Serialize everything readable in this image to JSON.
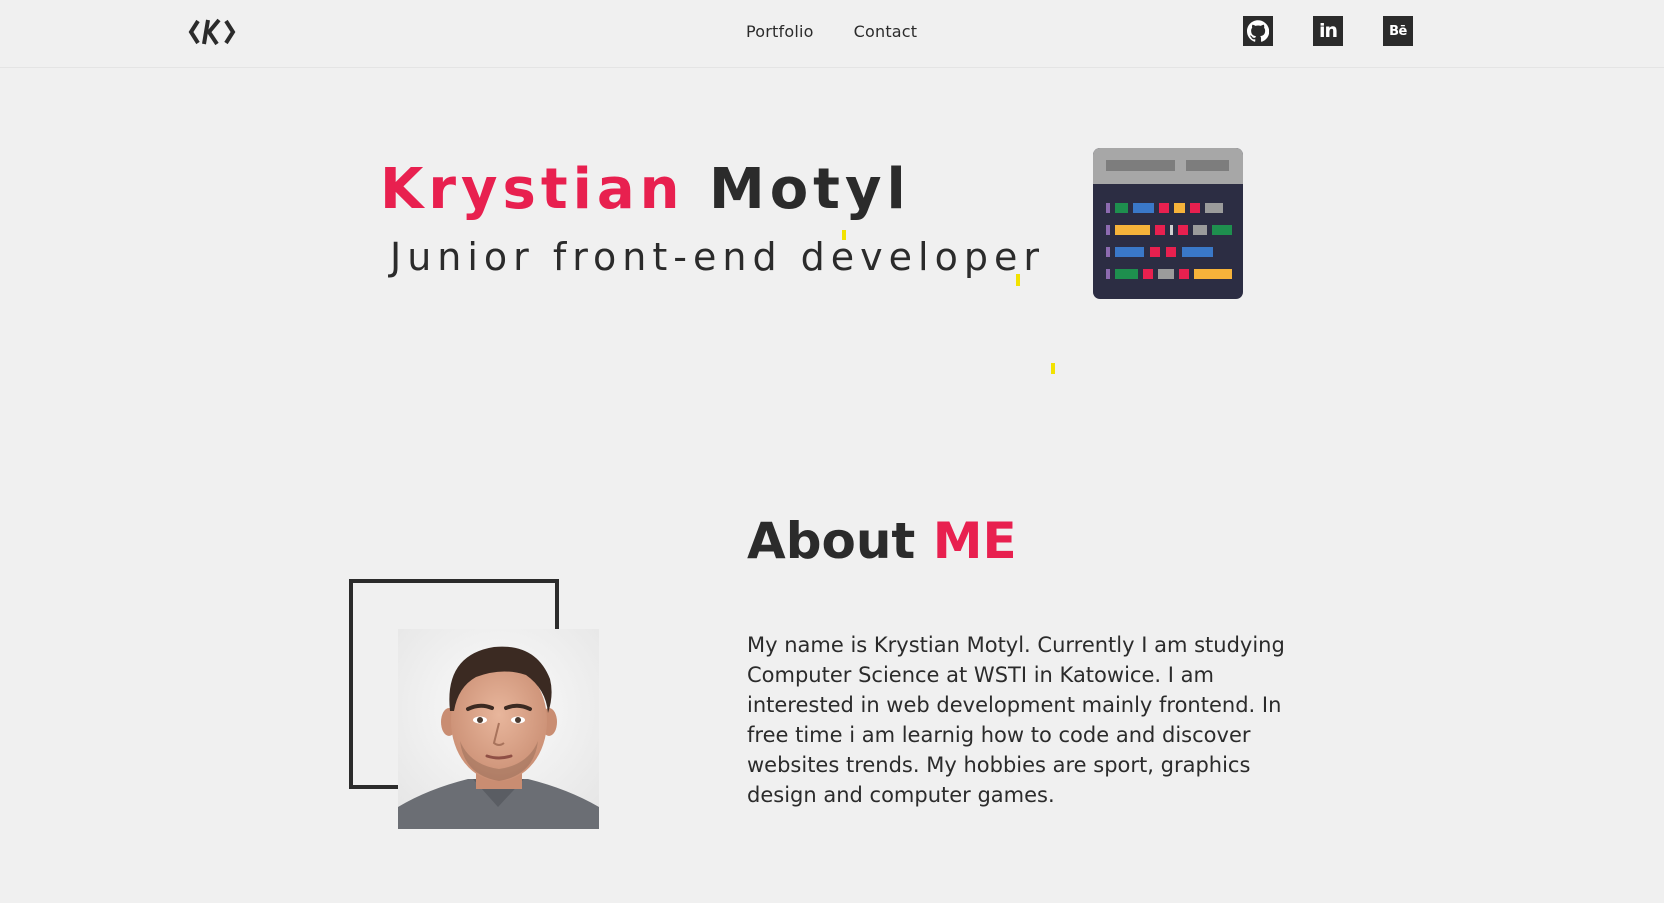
{
  "nav": {
    "logo_text": "<K>",
    "links": [
      {
        "label": "Portfolio"
      },
      {
        "label": "Contact"
      }
    ],
    "social": [
      {
        "icon": "github-icon",
        "label": ""
      },
      {
        "icon": "linkedin-icon",
        "label": "in"
      },
      {
        "icon": "behance-icon",
        "label": "Bē"
      }
    ]
  },
  "hero": {
    "first_name": "Krystian",
    "last_name": "Motyl",
    "role": "Junior front-end developer"
  },
  "about": {
    "title_a": "About",
    "title_b": "ME",
    "text": "My name is Krystian Motyl. Currently I am studying Computer Science at WSTI in Katowice. I am interested in web development mainly frontend. In free time i am learnig how to code and discover websites trends. My hobbies are sport, graphics design and computer games."
  },
  "colors": {
    "accent": "#e8204f",
    "text": "#2b2b2b",
    "background": "#f0f0f0",
    "spark": "#f2e200"
  }
}
